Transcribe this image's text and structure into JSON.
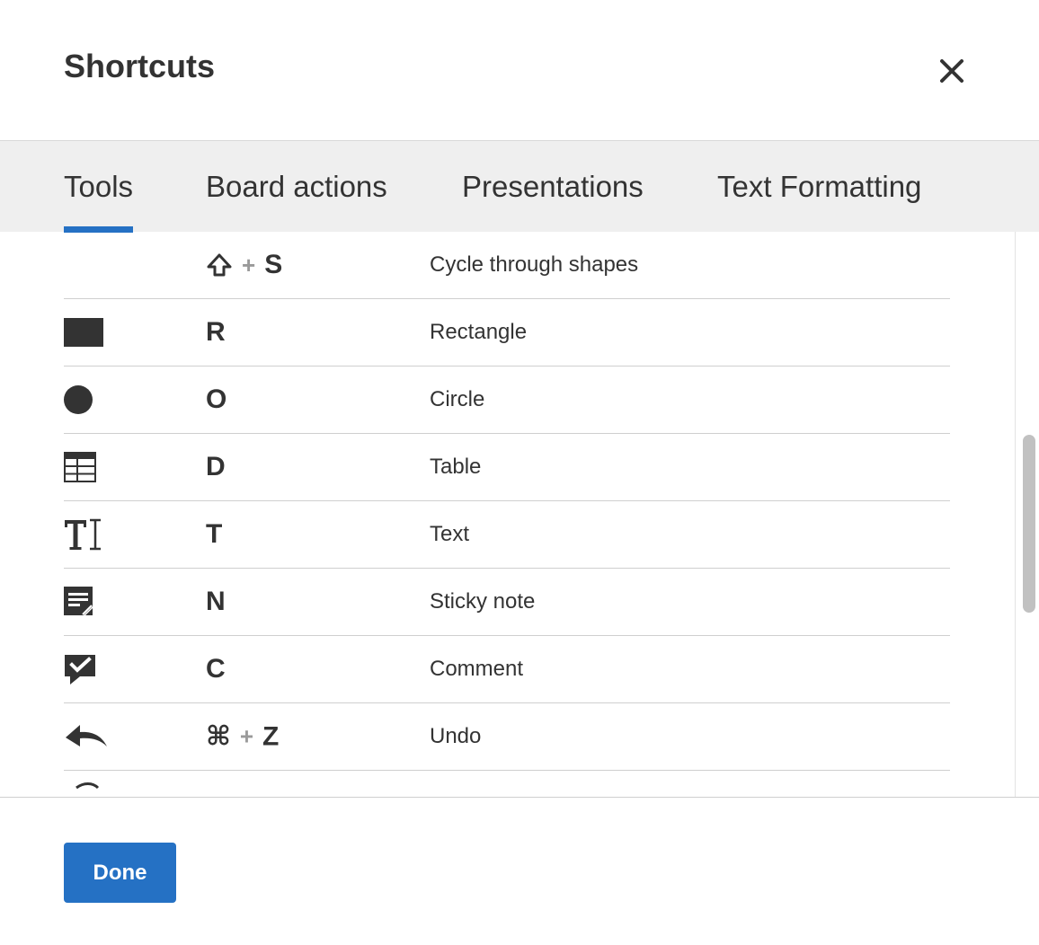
{
  "dialog": {
    "title": "Shortcuts",
    "close_icon": "close-icon"
  },
  "tabs": [
    {
      "label": "Tools",
      "active": true
    },
    {
      "label": "Board actions",
      "active": false
    },
    {
      "label": "Presentations",
      "active": false
    },
    {
      "label": "Text Formatting",
      "active": false
    }
  ],
  "shortcuts": [
    {
      "icon": "",
      "keys": [
        "⇧",
        "S"
      ],
      "description": "Cycle through shapes"
    },
    {
      "icon": "rectangle-icon",
      "keys": [
        "R"
      ],
      "description": "Rectangle"
    },
    {
      "icon": "circle-icon",
      "keys": [
        "O"
      ],
      "description": "Circle"
    },
    {
      "icon": "table-icon",
      "keys": [
        "D"
      ],
      "description": "Table"
    },
    {
      "icon": "text-icon",
      "keys": [
        "T"
      ],
      "description": "Text"
    },
    {
      "icon": "sticky-note-icon",
      "keys": [
        "N"
      ],
      "description": "Sticky note"
    },
    {
      "icon": "comment-icon",
      "keys": [
        "C"
      ],
      "description": "Comment"
    },
    {
      "icon": "undo-icon",
      "keys": [
        "⌘",
        "Z"
      ],
      "description": "Undo"
    }
  ],
  "plus_sign": "+",
  "footer": {
    "done_label": "Done"
  },
  "colors": {
    "accent": "#2571c4",
    "tab_bar": "#efefef",
    "text": "#333333"
  }
}
